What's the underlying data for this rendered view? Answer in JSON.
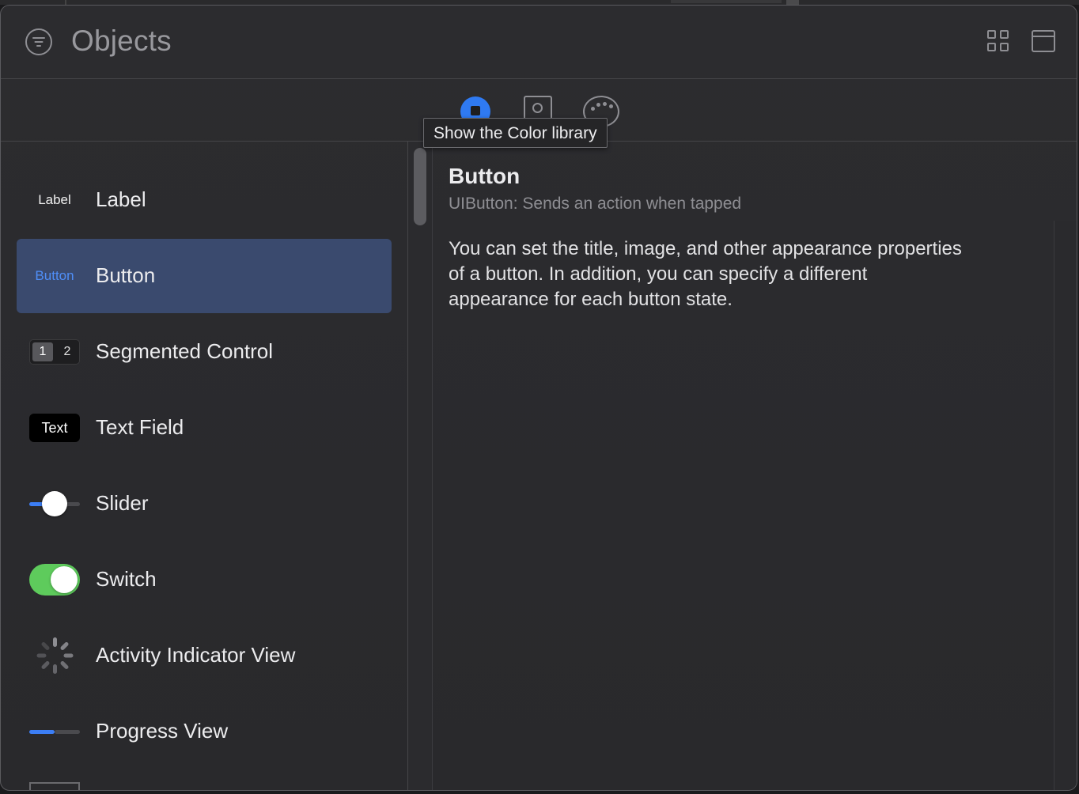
{
  "header": {
    "title": "Objects",
    "filter_icon": "filter-icon",
    "grid_icon": "grid-view-icon",
    "window_icon": "window-icon"
  },
  "library_tabs": [
    {
      "name": "objects",
      "icon": "square-in-circle-icon",
      "selected": true
    },
    {
      "name": "media",
      "icon": "photo-icon",
      "selected": false
    },
    {
      "name": "colors",
      "icon": "palette-icon",
      "selected": false
    }
  ],
  "tooltip": "Show the Color library",
  "objects": [
    {
      "icon_text": "Label",
      "name": "Label"
    },
    {
      "icon_text": "Button",
      "name": "Button",
      "selected": true
    },
    {
      "icon_text": "1",
      "icon_text2": "2",
      "name": "Segmented Control"
    },
    {
      "icon_text": "Text",
      "name": "Text Field"
    },
    {
      "name": "Slider",
      "value": 0.5
    },
    {
      "name": "Switch",
      "on": true
    },
    {
      "name": "Activity Indicator View"
    },
    {
      "name": "Progress View",
      "progress": 0.5
    }
  ],
  "detail": {
    "title": "Button",
    "subtitle": "UIButton: Sends an action when tapped",
    "description": "You can set the title, image, and other appearance properties of a button. In addition, you can specify a different appearance for each button state."
  },
  "colors": {
    "accent": "#2f7af2",
    "selection": "#3a4a6e",
    "switch_on": "#5ecb5c",
    "button_text": "#4f8ef7"
  }
}
